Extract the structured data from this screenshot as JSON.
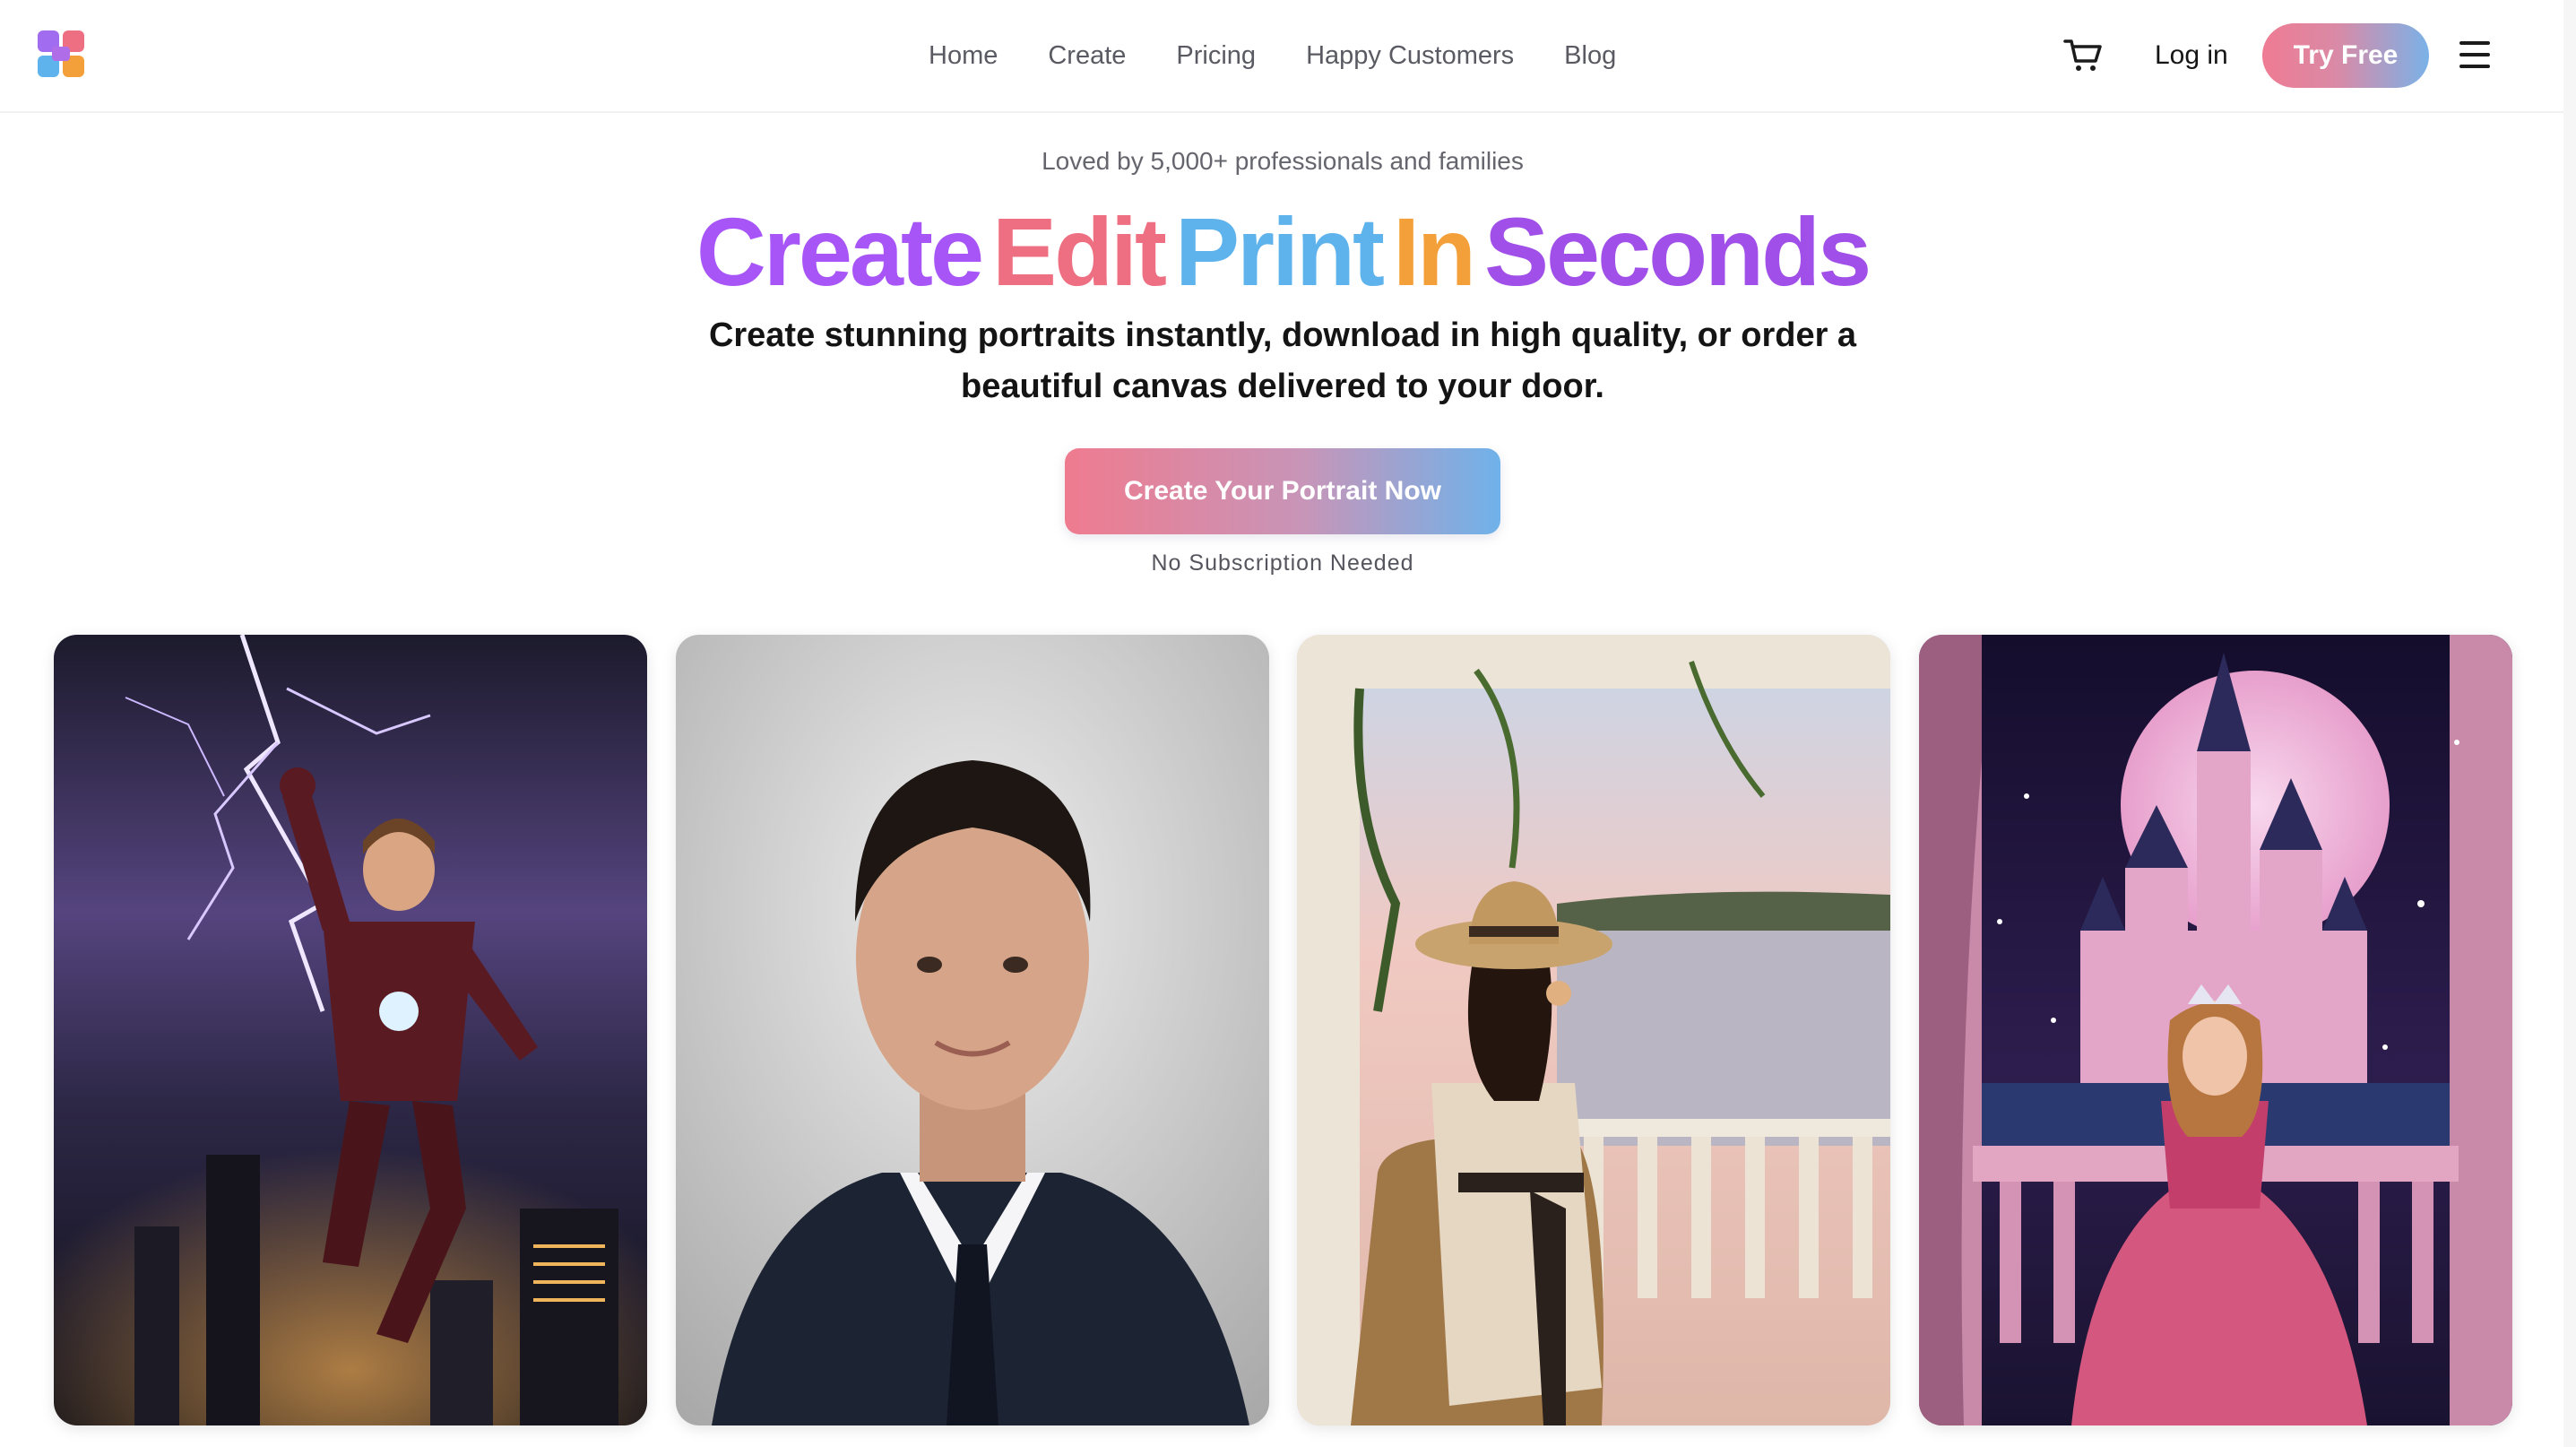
{
  "nav": {
    "links": [
      "Home",
      "Create",
      "Pricing",
      "Happy Customers",
      "Blog"
    ],
    "login_label": "Log in",
    "try_free_label": "Try Free"
  },
  "hero": {
    "loved_text": "Loved by 5,000+ professionals and families",
    "headline_words": [
      {
        "text": "Create",
        "color": "#a855f7"
      },
      {
        "text": "Edit",
        "color": "#ef6f82"
      },
      {
        "text": "Print",
        "color": "#5fb3ec"
      },
      {
        "text": "In",
        "color": "#f4a03a"
      },
      {
        "text": "Seconds",
        "color": "#a050e8"
      }
    ],
    "subtext": "Create stunning portraits instantly, download in high quality, or order a beautiful canvas delivered to your door.",
    "cta_label": "Create Your Portrait Now",
    "cta_note": "No Subscription Needed"
  },
  "gallery": {
    "cards": [
      {
        "subject": "boy-superhero-lightning-city"
      },
      {
        "subject": "man-business-headshot"
      },
      {
        "subject": "woman-sun-hat-porch-lake"
      },
      {
        "subject": "girl-princess-castle-moon"
      }
    ]
  },
  "colors": {
    "brand_gradient_start": "#ef7b93",
    "brand_gradient_end": "#6fb2ea",
    "nav_text": "#5a5a63"
  }
}
